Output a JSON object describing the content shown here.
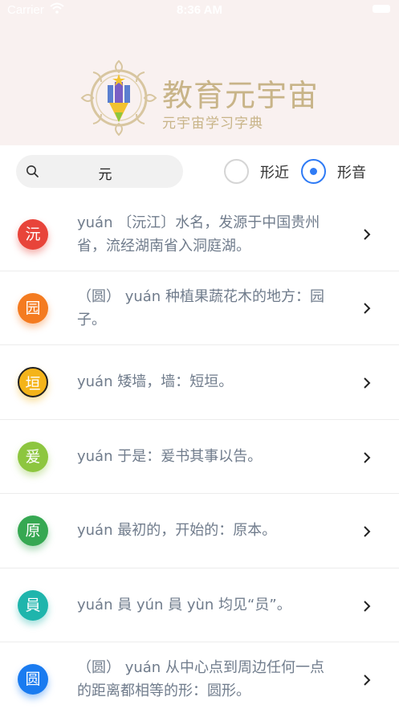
{
  "status_bar": {
    "carrier": "Carrier",
    "time": "8:36 AM"
  },
  "header": {
    "title": "教育元宇宙",
    "subtitle": "元宇宙学习字典"
  },
  "search": {
    "value": "元"
  },
  "filter": {
    "options": [
      "形近",
      "形音"
    ],
    "selected": "形音"
  },
  "list": [
    {
      "char": "沅",
      "desc": "yuán 〔沅江〕水名，发源于中国贵州省，流经湖南省入洞庭湖。",
      "color": "#e8443a"
    },
    {
      "char": "园",
      "desc": "（圆） yuán 种植果蔬花木的地方：园子。",
      "color": "#f47b20"
    },
    {
      "char": "垣",
      "desc": "yuán 矮墙，墙：短垣。",
      "color": "#f4b41a"
    },
    {
      "char": "爰",
      "desc": "yuán 于是：爰书其事以告。",
      "color": "#8dc63f"
    },
    {
      "char": "原",
      "desc": "yuán 最初的，开始的：原本。",
      "color": "#36a852"
    },
    {
      "char": "員",
      "desc": "yuán 員 yún 員 yùn 均见“员”。",
      "color": "#1fb5ac"
    },
    {
      "char": "圆",
      "desc": "（圆） yuán 从中心点到周边任何一点的距离都相等的形：圆形。",
      "color": "#1a7bf0"
    }
  ]
}
